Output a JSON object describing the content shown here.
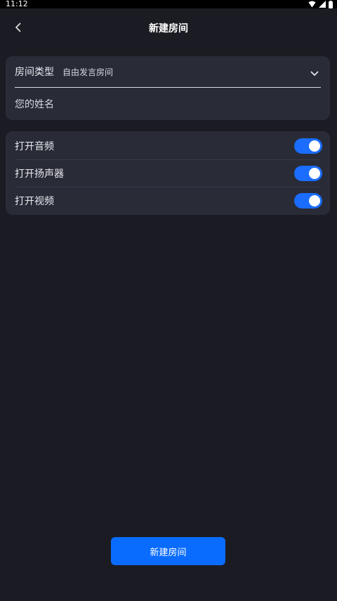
{
  "status_bar": {
    "time": "11:12",
    "icons": [
      "wifi-icon",
      "signal-icon",
      "battery-icon"
    ]
  },
  "header": {
    "title": "新建房间",
    "back_icon": "chevron-left-icon"
  },
  "room_form": {
    "room_type_label": "房间类型",
    "room_type_value": "自由发言房间",
    "dropdown_icon": "chevron-down-icon",
    "name_placeholder": "您的姓名",
    "name_value": ""
  },
  "media_settings": {
    "items": [
      {
        "label": "打开音频",
        "enabled": true
      },
      {
        "label": "打开扬声器",
        "enabled": true
      },
      {
        "label": "打开视频",
        "enabled": true
      }
    ]
  },
  "actions": {
    "create_label": "新建房间"
  },
  "colors": {
    "background": "#1b1c23",
    "card": "#292b37",
    "accent": "#0a6cff"
  }
}
